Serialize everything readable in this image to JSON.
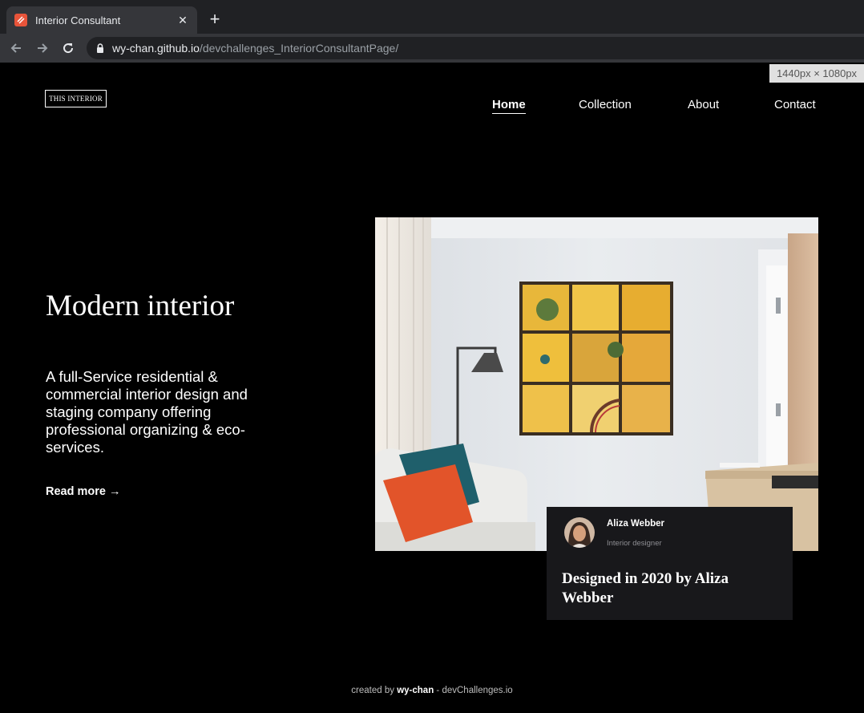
{
  "browser": {
    "tab_title": "Interior Consultant",
    "url_host": "wy-chan.github.io",
    "url_path": "/devchallenges_InteriorConsultantPage/",
    "viewport_badge": "1440px × 1080px"
  },
  "site": {
    "logo": "THIS INTERIOR",
    "nav": [
      {
        "label": "Home",
        "active": true
      },
      {
        "label": "Collection",
        "active": false
      },
      {
        "label": "About",
        "active": false
      },
      {
        "label": "Contact",
        "active": false
      }
    ]
  },
  "hero": {
    "title": "Modern interior",
    "description": "A full-Service residential & commercial interior design and staging company offering professional organizing & eco-services.",
    "read_more": "Read more →"
  },
  "designer_card": {
    "name": "Aliza Webber",
    "role": "Interior designer",
    "headline": "Designed in 2020 by Aliza Webber"
  },
  "footer": {
    "prefix": "created by",
    "author": "wy-chan",
    "suffix": "- devChallenges.io"
  }
}
